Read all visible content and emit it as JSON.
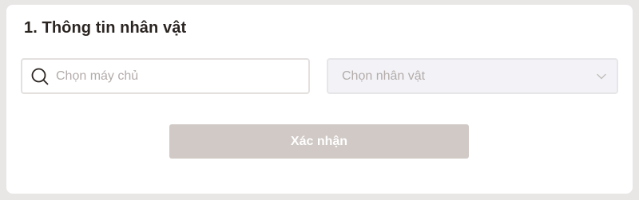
{
  "section": {
    "title": "1. Thông tin nhân vật"
  },
  "server_search": {
    "placeholder": "Chọn máy chủ",
    "value": "",
    "icon": "search-icon"
  },
  "character_select": {
    "placeholder": "Chọn nhân vật",
    "icon": "chevron-down-icon"
  },
  "confirm_button": {
    "label": "Xác nhận"
  },
  "colors": {
    "page_background": "#e9e7e6",
    "card_background": "#ffffff",
    "title_text": "#2b2522",
    "placeholder_text": "#b3acaa",
    "input_border": "#e3e0de",
    "select_background": "#f3f3f7",
    "button_background": "#d0c9c6",
    "button_text": "#ffffff"
  }
}
